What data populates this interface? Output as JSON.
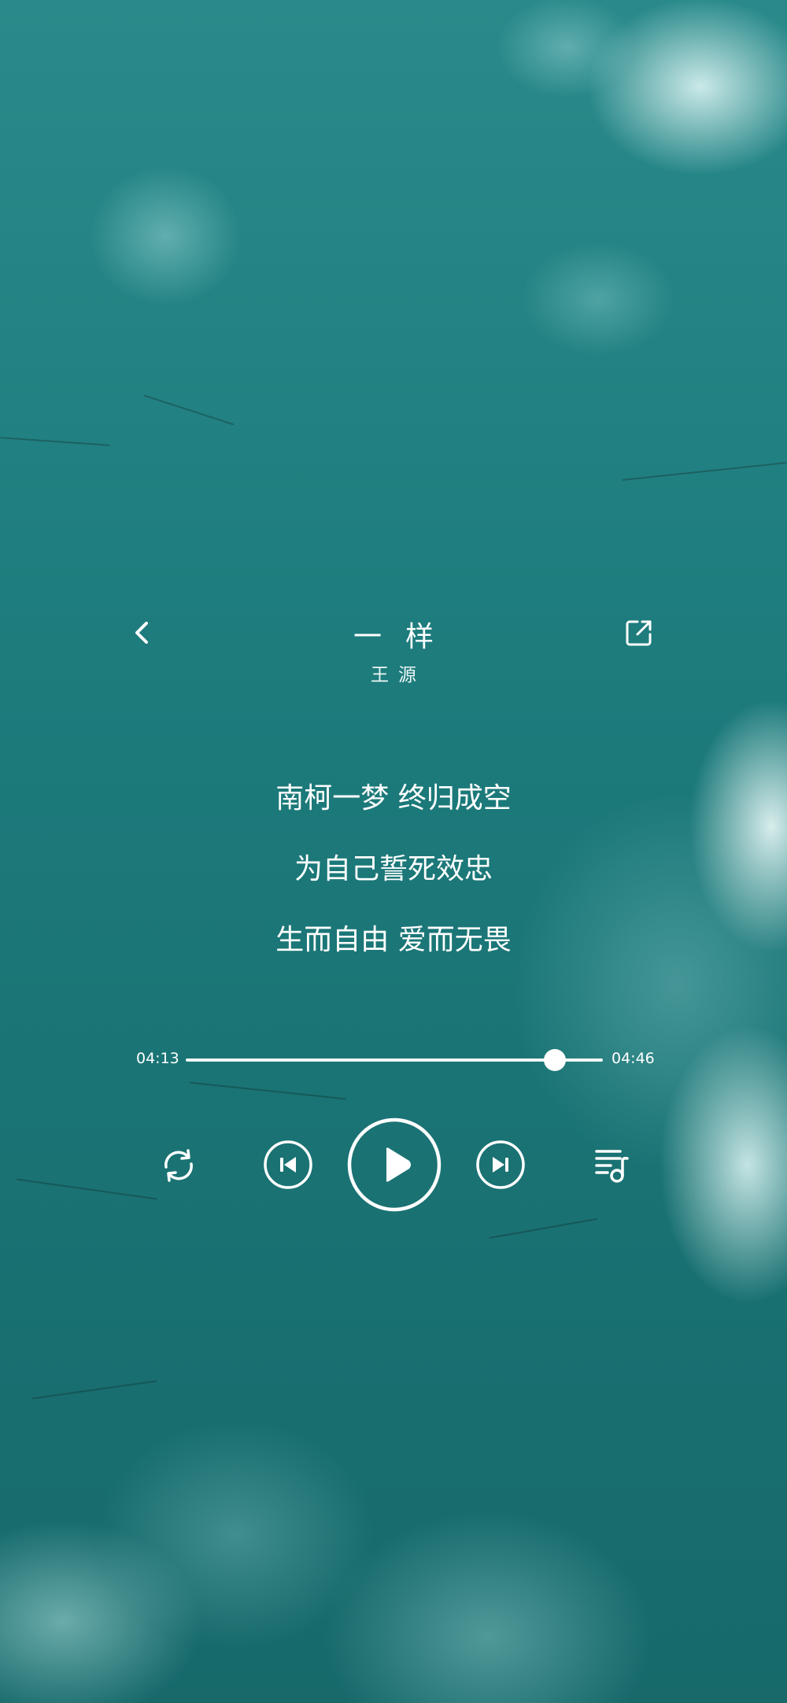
{
  "song": {
    "title": "一样",
    "artist": "王源"
  },
  "lyrics": [
    "南柯一梦 终归成空",
    "为自己誓死效忠",
    "生而自由 爱而无畏"
  ],
  "progress": {
    "current_time": "04:13",
    "total_time": "04:46",
    "fraction": 0.885
  },
  "icons": {
    "back": "chevron-left-icon",
    "share": "share-external-icon",
    "repeat": "repeat-icon",
    "previous": "previous-track-icon",
    "play": "play-icon",
    "next": "next-track-icon",
    "playlist": "playlist-icon"
  },
  "colors": {
    "background": "#1f7f80",
    "foreground": "#ffffff"
  }
}
